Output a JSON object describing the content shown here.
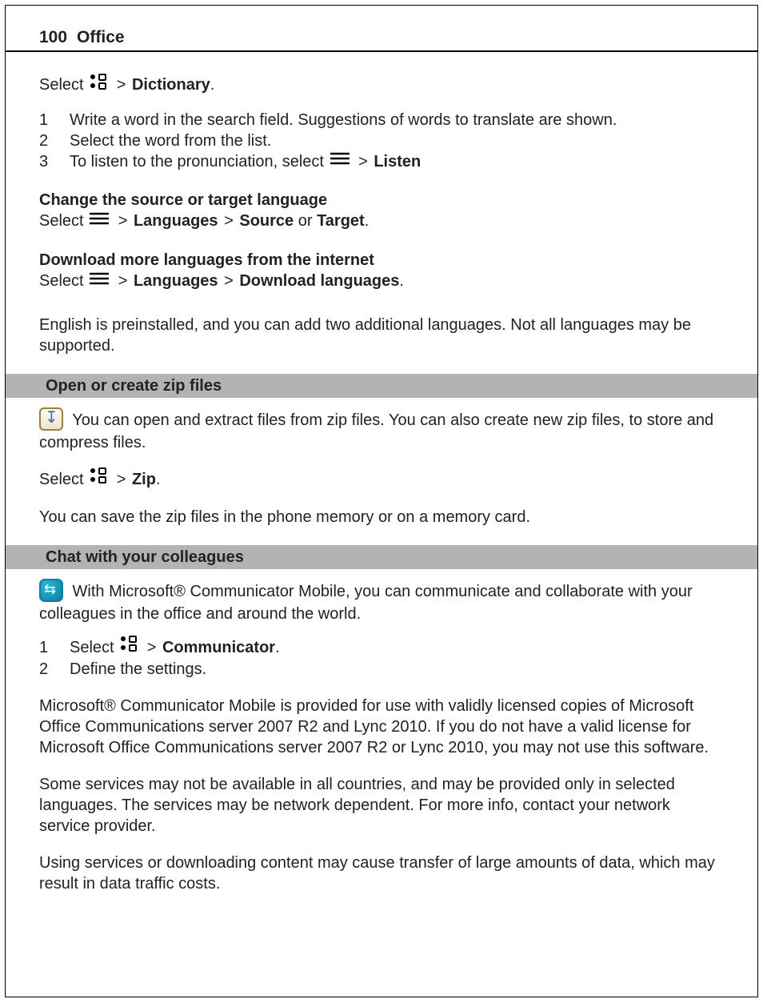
{
  "header": {
    "page_number": "100",
    "title": "Office"
  },
  "dict": {
    "select_prefix": "Select ",
    "chev": " > ",
    "dictionary": "Dictionary",
    "period": ".",
    "step1": "Write a word in the search field. Suggestions of words to translate are shown.",
    "step2": "Select the word from the list.",
    "step3_a": "To listen to the pronunciation, select ",
    "step3_listen": "Listen",
    "change_head": "Change the source or target language",
    "change_line_select": "Select ",
    "change_languages": "Languages",
    "change_source": "Source",
    "change_or": " or ",
    "change_target": "Target",
    "download_head": "Download more languages from the internet",
    "download_select": "Select ",
    "download_languages": "Languages",
    "download_dl": "Download languages",
    "english_note": "English is preinstalled, and you can add two additional languages. Not all languages may be supported."
  },
  "zip": {
    "bar": "Open or create zip files",
    "body": " You can open and extract files from zip files. You can also create new zip files, to store and compress files.",
    "select_prefix": "Select ",
    "chev": " > ",
    "zip_label": "Zip",
    "period": ".",
    "note": "You can save the zip files in the phone memory or on a memory card."
  },
  "chat": {
    "bar": "Chat with your colleagues",
    "body": " With Microsoft® Communicator Mobile, you can communicate and collaborate with your colleagues in the office and around the world.",
    "step1_a": "Select ",
    "step1_chev": " > ",
    "step1_comm": "Communicator",
    "step1_period": ".",
    "step2": "Define the settings.",
    "license": "Microsoft® Communicator Mobile is provided for use with validly licensed copies of Microsoft Office Communications server 2007 R2 and Lync 2010. If you do not have a valid license for Microsoft Office Communications server 2007 R2 or Lync 2010, you may not use this software.",
    "services": "Some services may not be available in all countries, and may be provided only in selected languages. The services may be network dependent. For more info, contact your network service provider.",
    "data": "Using services or downloading content may cause transfer of large amounts of data, which may result in data traffic costs."
  }
}
